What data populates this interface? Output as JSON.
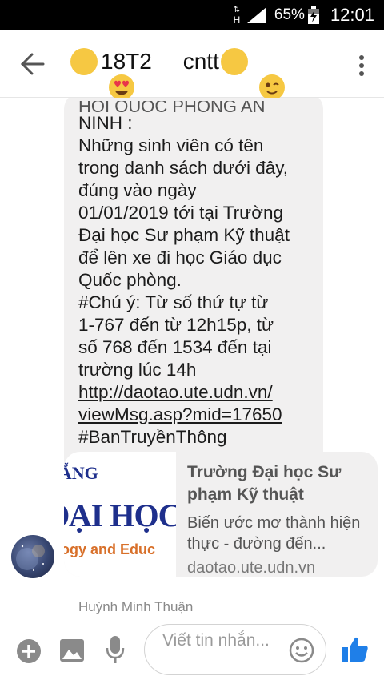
{
  "status_bar": {
    "network": "H",
    "battery": "65%",
    "time": "12:01"
  },
  "header": {
    "title": "18T2     cntt"
  },
  "message": {
    "cut_text": "HỘI QUỐC PHÒNG AN",
    "lines": [
      "NINH :",
      "Những sinh viên có tên",
      "trong danh sách dưới đây,",
      "đúng vào ngày",
      "01/01/2019 tới tại Trường",
      "Đại học Sư phạm Kỹ thuật",
      "để lên xe đi học Giáo dục",
      "Quốc phòng.",
      "#Chú ý: Từ số thứ tự từ",
      "1-767 đến từ 12h15p, từ",
      "số 768 đến 1534 đến tại",
      "trường lúc 14h"
    ],
    "link_line1": "http://daotao.ute.udn.vn/",
    "link_line2": "viewMsg.asp?mid=17650",
    "hashtag": "#BanTruyềnThông"
  },
  "link_preview": {
    "thumb_line1": "NẴNG",
    "thumb_line2": "ĐẠI HỌC S",
    "thumb_line3": "hnology and Educ",
    "title": "Trường Đại học Sư phạm Kỹ thuật",
    "description": "Biến ước mơ thành hiện thực - đường đến...",
    "domain": "daotao.ute.udn.vn"
  },
  "sender_name": "Huỳnh Minh Thuận",
  "composer": {
    "placeholder": "Viết tin nhắn..."
  },
  "colors": {
    "accent": "#1f7fe8",
    "bubble": "#f1f0f0",
    "icon": "#8a8a8a"
  }
}
